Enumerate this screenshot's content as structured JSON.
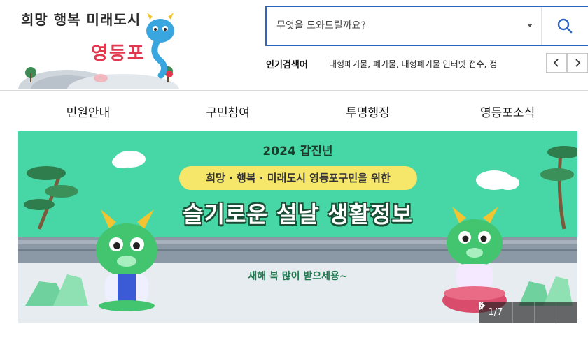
{
  "logo": {
    "line1": "희망 행복 미래도시",
    "line2": "영등포"
  },
  "search": {
    "placeholder": "무엇을 도와드릴까요?",
    "button_icon": "search-icon"
  },
  "popular": {
    "label": "인기검색어",
    "items": "대형폐기물, 폐기물, 대형폐기물 인터넷 접수, 정",
    "prev_icon": "chevron-left-icon",
    "next_icon": "chevron-right-icon"
  },
  "nav": {
    "items": [
      {
        "label": "민원안내"
      },
      {
        "label": "구민참여"
      },
      {
        "label": "투명행정"
      },
      {
        "label": "영등포소식"
      }
    ]
  },
  "banner": {
    "year": "2024 갑진년",
    "pill": "희망 · 행복 · 미래도시 영등포구민을 위한",
    "title": "슬기로운 설날 생활정보",
    "greeting": "새해 복 많이 받으세용~",
    "counter": "1/7",
    "colors": {
      "background": "#47d7a6",
      "wall": "#8b98a6",
      "ground": "#e6ecef",
      "pill": "#f6e66a"
    }
  },
  "colors": {
    "accent": "#2f64c4",
    "brand_red": "#e2384d"
  }
}
